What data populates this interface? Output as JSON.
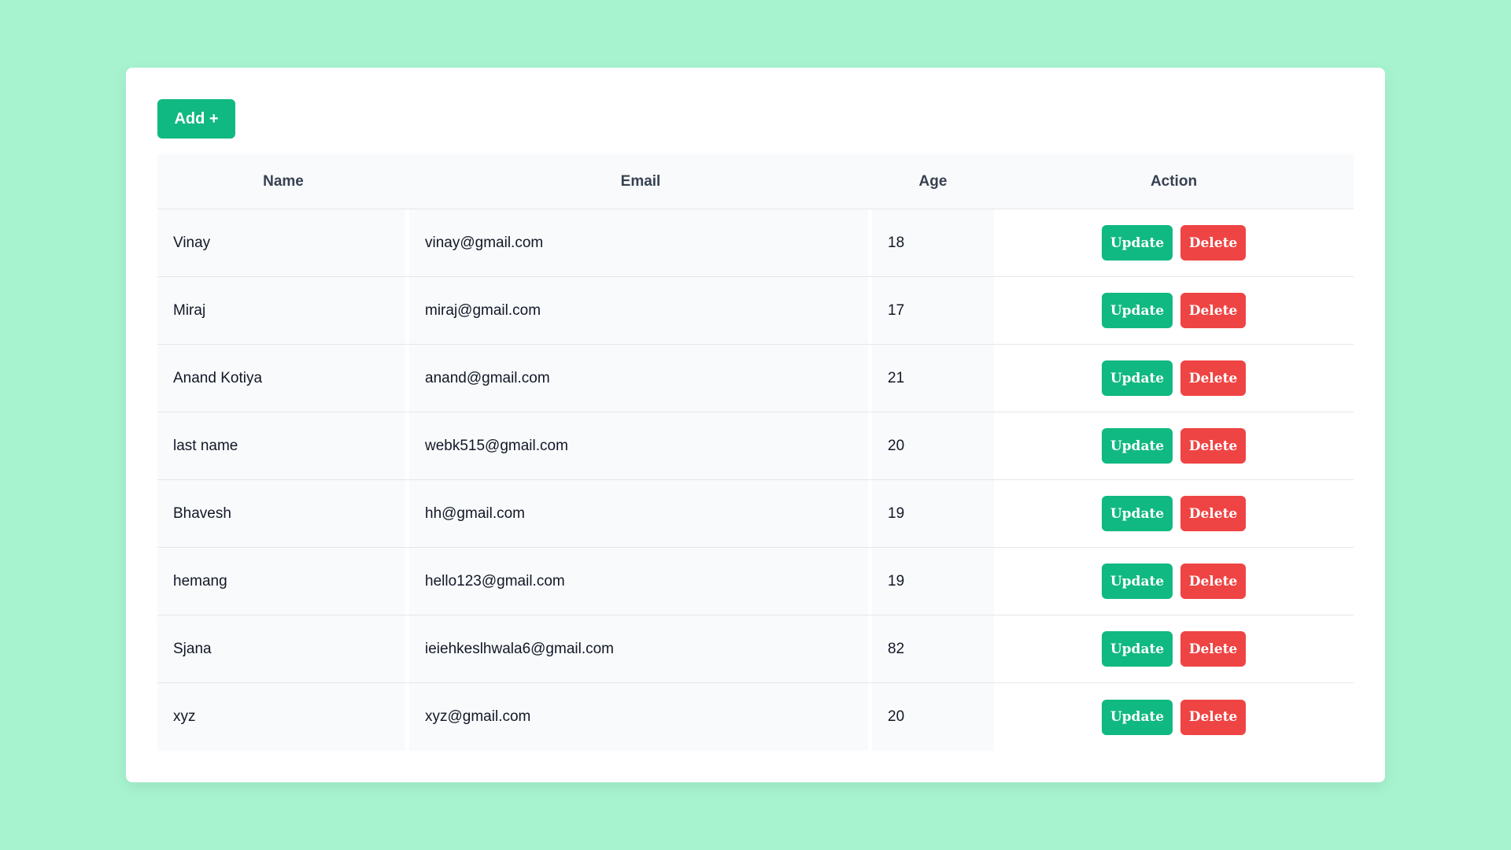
{
  "toolbar": {
    "add_label": "Add +"
  },
  "table": {
    "headers": [
      "Name",
      "Email",
      "Age",
      "Action"
    ],
    "rows": [
      {
        "name": "Vinay",
        "email": "vinay@gmail.com",
        "age": "18"
      },
      {
        "name": "Miraj",
        "email": "miraj@gmail.com",
        "age": "17"
      },
      {
        "name": "Anand Kotiya",
        "email": "anand@gmail.com",
        "age": "21"
      },
      {
        "name": "last name",
        "email": "webk515@gmail.com",
        "age": "20"
      },
      {
        "name": "Bhavesh",
        "email": "hh@gmail.com",
        "age": "19"
      },
      {
        "name": "hemang",
        "email": "hello123@gmail.com",
        "age": "19"
      },
      {
        "name": "Sjana",
        "email": "ieiehkeslhwala6@gmail.com",
        "age": "82"
      },
      {
        "name": "xyz",
        "email": "xyz@gmail.com",
        "age": "20"
      }
    ],
    "update_label": "Update",
    "delete_label": "Delete"
  },
  "colors": {
    "background": "#a7f3d0",
    "primary": "#10b981",
    "danger": "#ef4444"
  }
}
